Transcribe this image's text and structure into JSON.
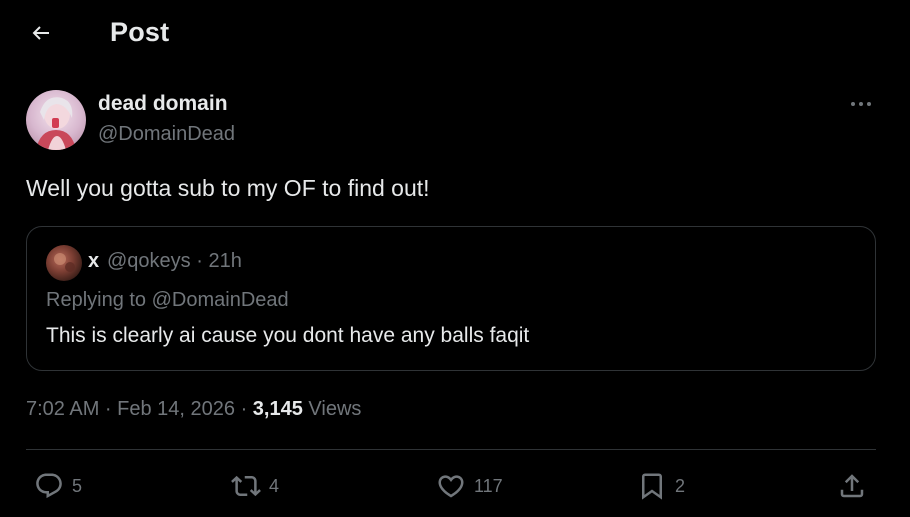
{
  "header": {
    "title": "Post",
    "back_icon": "arrow-left-icon"
  },
  "post": {
    "author_name": "dead domain",
    "author_handle": "@DomainDead",
    "text": "Well you gotta sub to my OF to find out!",
    "timestamp": "7:02 AM · Feb 14, 2026 · ",
    "views_count": "3,145",
    "views_label": " Views"
  },
  "quote": {
    "name": "x",
    "handle_time": "@qokeys · 21h",
    "replying_prefix": "Replying to ",
    "replying_handle": "@DomainDead",
    "text": "This is clearly ai cause you dont have any balls faqit"
  },
  "actions": {
    "replies": "5",
    "reposts": "4",
    "likes": "117",
    "bookmarks": "2"
  },
  "colors": {
    "background": "#000000",
    "text_primary": "#e7e9ea",
    "text_secondary": "#71767b",
    "border": "#2f3336"
  }
}
